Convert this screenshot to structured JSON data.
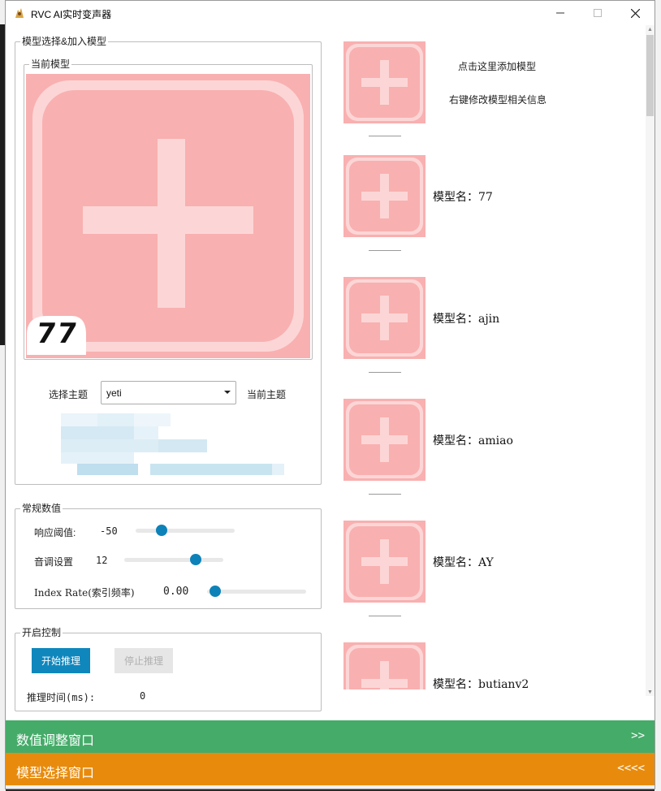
{
  "window": {
    "title": "RVC AI实时变声器"
  },
  "model_group": {
    "title": "模型选择&加入模型",
    "current_model_title": "当前模型",
    "current_badge": "77",
    "select_theme_label": "选择主题",
    "theme_value": "yeti",
    "current_theme_label": "当前主题"
  },
  "params_group": {
    "title": "常规数值",
    "threshold_label": "响应阈值:",
    "threshold_value": "-50",
    "threshold_level": 0.2,
    "pitch_label": "音调设置",
    "pitch_value": "12",
    "pitch_level": 0.72,
    "index_label": "Index Rate(索引频率)",
    "index_value": "0.00",
    "index_level": 0.0
  },
  "control_group": {
    "title": "开启控制",
    "start_label": "开始推理",
    "stop_label": "停止推理",
    "time_label": "推理时间(ms):",
    "time_value": "0"
  },
  "model_list": {
    "add_hint": "点击这里添加模型",
    "edit_hint": "右键修改模型相关信息",
    "items": [
      {
        "name": "模型名：77"
      },
      {
        "name": "模型名：ajin"
      },
      {
        "name": "模型名：amiao"
      },
      {
        "name": "模型名：AY"
      },
      {
        "name": "模型名：butianv2"
      }
    ]
  },
  "bottom_bars": {
    "params_window": "数值调整窗口",
    "params_arrow": ">>",
    "model_window": "模型选择窗口",
    "model_arrow": "<<<<"
  },
  "colors": {
    "accent": "#0f87bd",
    "green_bar": "#45ab69",
    "orange_bar": "#e88b0c",
    "plus_bg": "#f9b0b0",
    "plus_fg": "#fcd6d6"
  }
}
